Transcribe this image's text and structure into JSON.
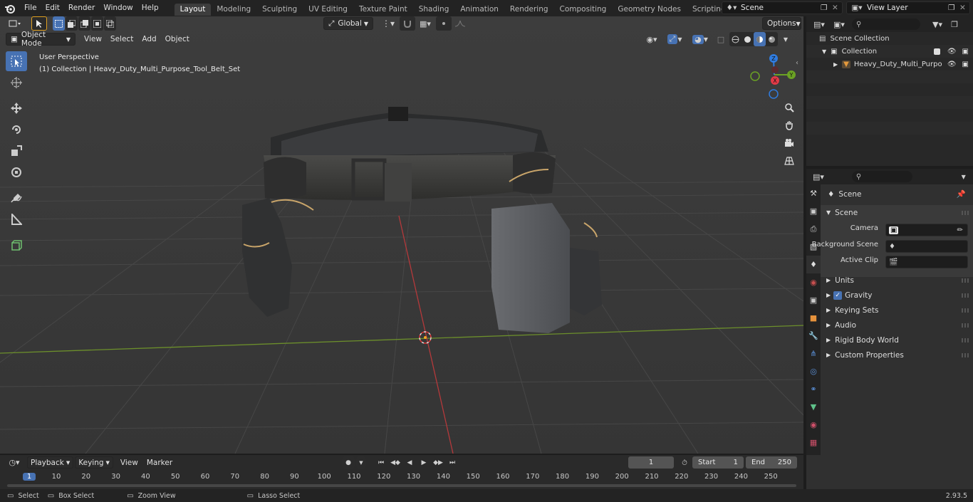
{
  "menu": {
    "file": "File",
    "edit": "Edit",
    "render": "Render",
    "window": "Window",
    "help": "Help"
  },
  "workspaces": [
    "Layout",
    "Modeling",
    "Sculpting",
    "UV Editing",
    "Texture Paint",
    "Shading",
    "Animation",
    "Rendering",
    "Compositing",
    "Geometry Nodes",
    "Scripting"
  ],
  "scene": {
    "name": "Scene",
    "view_layer": "View Layer"
  },
  "viewport": {
    "transform_orientation": "Global",
    "options": "Options",
    "mode": "Object Mode",
    "menus": {
      "view": "View",
      "select": "Select",
      "add": "Add",
      "object": "Object"
    },
    "perspective": "User Perspective",
    "collection_info": "(1) Collection | Heavy_Duty_Multi_Purpose_Tool_Belt_Set",
    "gizmo": {
      "x": "X",
      "y": "Y",
      "z": "Z"
    }
  },
  "outliner": {
    "scene_collection": "Scene Collection",
    "collection": "Collection",
    "object": "Heavy_Duty_Multi_Purpo"
  },
  "properties": {
    "header": "Scene",
    "panel": "Scene",
    "camera_label": "Camera",
    "bg_scene_label": "Background Scene",
    "active_clip_label": "Active Clip",
    "sections": [
      "Units",
      "Gravity",
      "Keying Sets",
      "Audio",
      "Rigid Body World",
      "Custom Properties"
    ],
    "gravity_checked": true
  },
  "timeline": {
    "menus": {
      "playback": "Playback",
      "keying": "Keying",
      "view": "View",
      "marker": "Marker"
    },
    "current_frame": "1",
    "start_label": "Start",
    "start": "1",
    "end_label": "End",
    "end": "250",
    "ticks": [
      "1",
      "10",
      "20",
      "30",
      "40",
      "50",
      "60",
      "70",
      "80",
      "90",
      "100",
      "110",
      "120",
      "130",
      "140",
      "150",
      "160",
      "170",
      "180",
      "190",
      "200",
      "210",
      "220",
      "230",
      "240",
      "250"
    ]
  },
  "status": {
    "select": "Select",
    "box_select": "Box Select",
    "zoom_view": "Zoom View",
    "lasso_select": "Lasso Select",
    "version": "2.93.5"
  },
  "colors": {
    "accent": "#4772b3",
    "x_axis": "#c8383f",
    "y_axis": "#6ba224",
    "z_axis": "#2f7ce0",
    "origin": "#f5a623"
  }
}
